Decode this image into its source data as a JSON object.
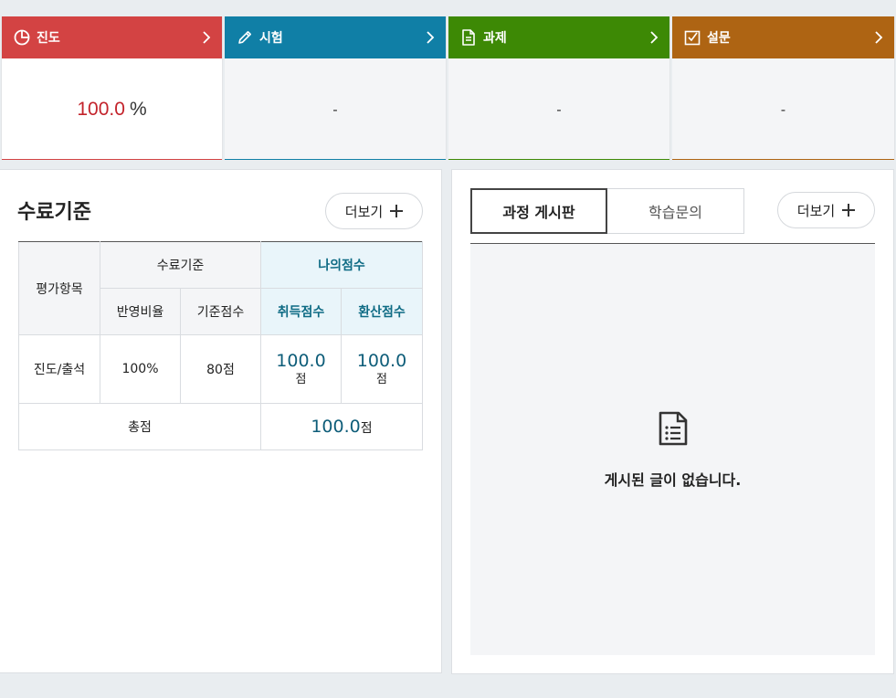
{
  "status_cards": [
    {
      "title": "진도",
      "icon": "pie-chart-icon",
      "color": "#d34343",
      "value": "100.0",
      "unit": "%",
      "value_color": "#c3232b"
    },
    {
      "title": "시험",
      "icon": "pencil-icon",
      "color": "#107fa6",
      "value": "-"
    },
    {
      "title": "과제",
      "icon": "document-icon",
      "color": "#3d8905",
      "value": "-"
    },
    {
      "title": "설문",
      "icon": "checkbox-icon",
      "color": "#ae6413",
      "value": "-"
    }
  ],
  "completion": {
    "title": "수료기준",
    "more_label": "더보기",
    "table": {
      "header_item": "평가항목",
      "header_criteria": "수료기준",
      "header_my_score": "나의점수",
      "sub_ratio": "반영비율",
      "sub_base": "기준점수",
      "sub_earned": "취득점수",
      "sub_converted": "환산점수",
      "rows": [
        {
          "item": "진도/출석",
          "ratio": "100%",
          "base": "80점",
          "earned": "100.0",
          "earned_unit": "점",
          "converted": "100.0",
          "converted_unit": "점"
        }
      ],
      "total_label": "총점",
      "total_value": "100.0",
      "total_unit": "점"
    }
  },
  "board": {
    "tabs": [
      "과정 게시판",
      "학습문의"
    ],
    "active_tab": 0,
    "more_label": "더보기",
    "empty_message": "게시된 글이 없습니다."
  },
  "colors": {
    "progress": "#d34343",
    "exam": "#107fa6",
    "assignment": "#3d8905",
    "survey": "#ae6413",
    "score_text": "#0e5d79"
  }
}
